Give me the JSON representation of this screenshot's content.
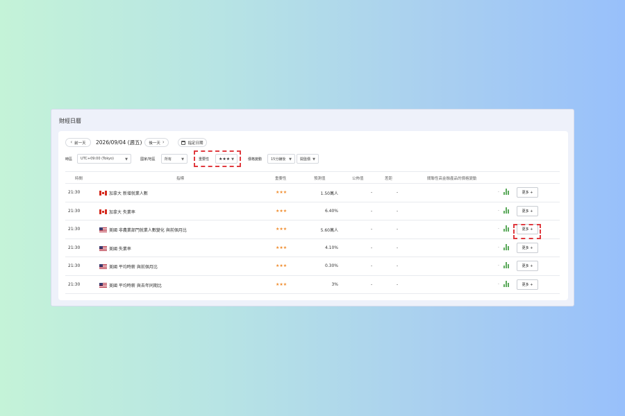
{
  "title": "財經日曆",
  "nav": {
    "prev_label": "前一天",
    "date": "2026/09/04 (週五)",
    "next_label": "後一天",
    "pick_date_label": "指定日期"
  },
  "filters": {
    "timezone_label": "時區",
    "timezone_value": "UTC+09:00 (Tokyo)",
    "country_label": "國家/地區",
    "country_value": "所有",
    "importance_label": "重要性",
    "importance_value": "★★★",
    "price_label": "價格變動",
    "interval_value": "15分鐘後",
    "price_type_value": "開盤價"
  },
  "columns": {
    "time": "時間",
    "indicator": "指標",
    "importance": "重要性",
    "forecast": "預測值",
    "actual": "公佈值",
    "diff": "差距",
    "price_change": "關聯性高金融產品的價格變動"
  },
  "rows": [
    {
      "time": "21:30",
      "flag": "ca",
      "indicator": "加拿大 新增就業人數",
      "stars": "★★★",
      "forecast": "1.50萬人",
      "actual": "-",
      "diff": "-",
      "more": "更多 +"
    },
    {
      "time": "21:30",
      "flag": "ca",
      "indicator": "加拿大 失業率",
      "stars": "★★★",
      "forecast": "6.40%",
      "actual": "-",
      "diff": "-",
      "more": "更多 +"
    },
    {
      "time": "21:30",
      "flag": "us",
      "indicator": "美國 非農業部門就業人數變化 與前個月比",
      "stars": "★★★",
      "forecast": "5.60萬人",
      "actual": "-",
      "diff": "-",
      "more": "更多 +"
    },
    {
      "time": "21:30",
      "flag": "us",
      "indicator": "美國 失業率",
      "stars": "★★★",
      "forecast": "4.10%",
      "actual": "-",
      "diff": "-",
      "more": "更多 +"
    },
    {
      "time": "21:30",
      "flag": "us",
      "indicator": "美國 平均時薪 與前個月比",
      "stars": "★★★",
      "forecast": "0.30%",
      "actual": "-",
      "diff": "-",
      "more": "更多 +"
    },
    {
      "time": "21:30",
      "flag": "us",
      "indicator": "美國 平均時薪 與去年同期比",
      "stars": "★★★",
      "forecast": "3%",
      "actual": "-",
      "diff": "-",
      "more": "更多 +"
    }
  ],
  "colors": {
    "star": "#f08c2e",
    "chart_bar": "#5aa95a",
    "highlight": "#e0393e"
  }
}
